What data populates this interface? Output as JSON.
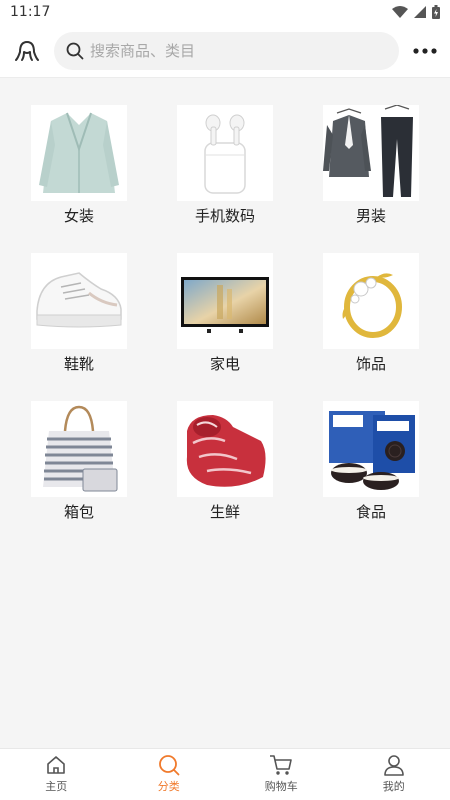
{
  "status_bar": {
    "time": "11:17",
    "icons": [
      "wifi-icon",
      "cellular-signal-icon",
      "battery-icon"
    ]
  },
  "header": {
    "logo_icon": "octopus-logo-icon",
    "search": {
      "placeholder": "搜索商品、类目",
      "value": ""
    },
    "more_icon": "more-dots-icon"
  },
  "categories": [
    {
      "label": "女装",
      "image": "women-blazer-image"
    },
    {
      "label": "手机数码",
      "image": "earbuds-image"
    },
    {
      "label": "男装",
      "image": "men-suit-image"
    },
    {
      "label": "鞋靴",
      "image": "sneaker-image"
    },
    {
      "label": "家电",
      "image": "television-image"
    },
    {
      "label": "饰品",
      "image": "ring-image"
    },
    {
      "label": "箱包",
      "image": "tote-bag-image"
    },
    {
      "label": "生鲜",
      "image": "meat-image"
    },
    {
      "label": "食品",
      "image": "cookies-image"
    }
  ],
  "tabbar": {
    "items": [
      {
        "label": "主页",
        "icon": "home-icon"
      },
      {
        "label": "分类",
        "icon": "category-search-icon"
      },
      {
        "label": "购物车",
        "icon": "cart-icon"
      },
      {
        "label": "我的",
        "icon": "user-icon"
      }
    ],
    "active_index": 1
  },
  "colors": {
    "accent": "#f07a2c",
    "background": "#f5f5f5"
  }
}
